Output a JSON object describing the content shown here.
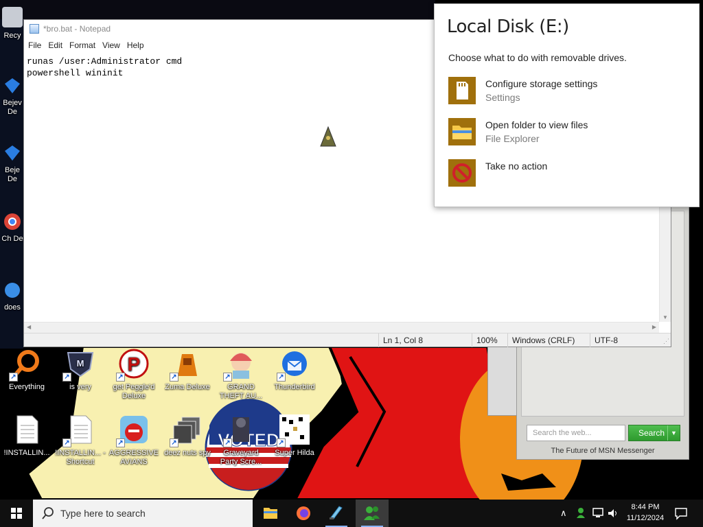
{
  "notepad": {
    "title": "*bro.bat - Notepad",
    "menu": [
      "File",
      "Edit",
      "Format",
      "View",
      "Help"
    ],
    "content": "runas /user:Administrator cmd\npowershell wininit",
    "status": {
      "position": "Ln 1, Col 8",
      "zoom": "100%",
      "line_ending": "Windows (CRLF)",
      "encoding": "UTF-8"
    }
  },
  "autoplay": {
    "title": "Local Disk (E:)",
    "subtitle": "Choose what to do with removable drives.",
    "options": [
      {
        "label": "Configure storage settings",
        "sub": "Settings",
        "icon": "sd-card-icon"
      },
      {
        "label": "Open folder to view files",
        "sub": "File Explorer",
        "icon": "folder-icon"
      },
      {
        "label": "Take no action",
        "sub": "",
        "icon": "no-action-icon"
      }
    ]
  },
  "msn": {
    "search_placeholder": "Search the web...",
    "search_button": "Search",
    "footer": "The Future of MSN Messenger"
  },
  "desktop": {
    "left_labels": [
      "Recy",
      "Bejev De",
      "Beje De",
      "Ch De",
      "does"
    ],
    "row1": [
      "Everything",
      "is very",
      "get Peggle'd Deluxe",
      "Zuma Deluxe",
      "GRAND THEFT AU...",
      "Thunderbird"
    ],
    "row2": [
      "!INSTALLIN...",
      "!INSTALLIN... - Shortcut",
      "AGGRESSIVE AVIANS",
      "deez nuts spy",
      "Graveyard Party Scre...",
      "Super Hilda"
    ],
    "badge_text": "VOTED"
  },
  "taskbar": {
    "search_placeholder": "Type here to search",
    "time": "8:44 PM",
    "date": "11/12/2024"
  },
  "colors": {
    "wallpaper_red": "#e01414",
    "wallpaper_cream": "#f8f0b0",
    "autoplay_icon_bg": "#a0700c",
    "msn_green": "#34a034",
    "taskbar": "#101010"
  }
}
